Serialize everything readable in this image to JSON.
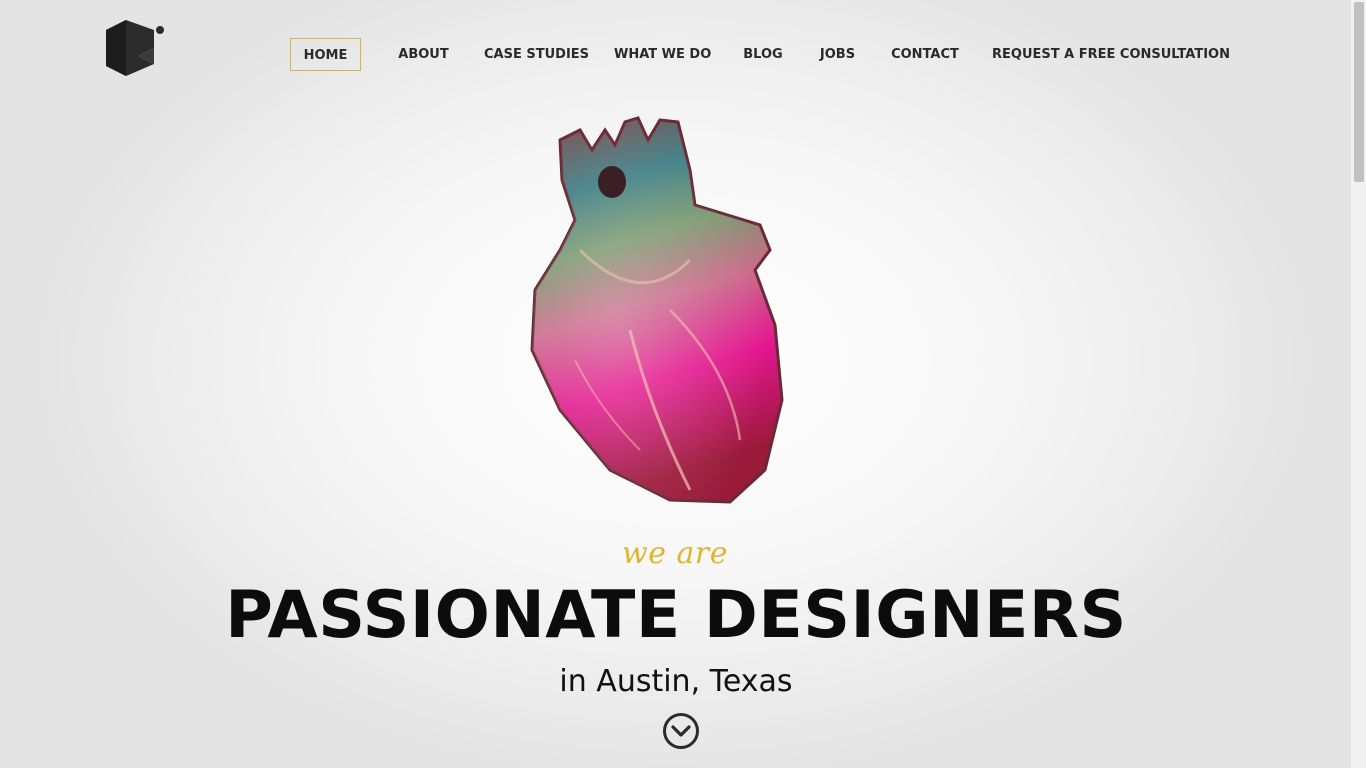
{
  "nav": {
    "items": [
      {
        "label": "HOME",
        "active": true
      },
      {
        "label": "ABOUT"
      },
      {
        "label": "CASE STUDIES"
      },
      {
        "label": "WHAT WE DO"
      },
      {
        "label": "BLOG"
      },
      {
        "label": "JOBS"
      },
      {
        "label": "CONTACT"
      },
      {
        "label": "REQUEST A FREE CONSULTATION"
      }
    ]
  },
  "hero": {
    "eyebrow": "we are",
    "headline": "PASSIONATE DESIGNERS",
    "subline": "in Austin, Texas",
    "image_icon": "anatomical-heart-illustration",
    "scroll_icon": "chevron-down-circle-icon"
  },
  "colors": {
    "accent": "#e1b52f",
    "active_border": "#d9b24a",
    "text": "#2a2a2a",
    "logo": "#2b2b2b"
  }
}
